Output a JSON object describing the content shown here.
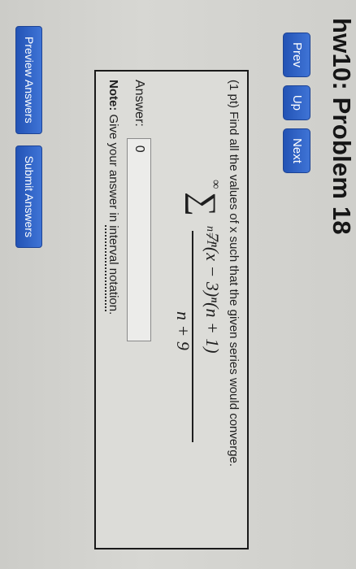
{
  "title": "hw10: Problem 18",
  "nav": {
    "prev_label": "Prev",
    "up_label": "Up",
    "next_label": "Next"
  },
  "problem": {
    "prompt": "(1 pt) Find all the values of x such that the given series would converge.",
    "series": {
      "upper_limit": "∞",
      "sigma": "∑",
      "lower_limit": "n=1",
      "numerator": "7ⁿ(x − 3)ⁿ(n + 1)",
      "denominator": "n + 9"
    },
    "answer_label": "Answer:",
    "answer_value": "0",
    "note_prefix": "Note:",
    "note_text": " Give your answer in ",
    "note_link": "interval notation",
    "note_suffix": "."
  },
  "actions": {
    "preview_label": "Preview Answers",
    "submit_label": "Submit Answers"
  },
  "colors": {
    "button_blue": "#2f62c4",
    "page_bg": "#d3d3d0"
  }
}
